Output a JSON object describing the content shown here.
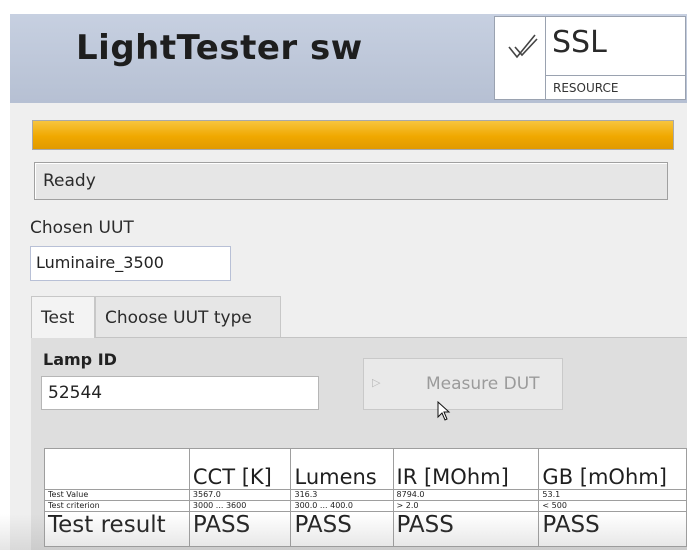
{
  "app": {
    "title": "LightTester sw"
  },
  "logo": {
    "text": "SSL",
    "subtext": "RESOURCE"
  },
  "progress": {
    "value": 1.0,
    "color": "#f0a800"
  },
  "status": {
    "text": "Ready"
  },
  "chosen_uut": {
    "label": "Chosen UUT",
    "value": "Luminaire_3500"
  },
  "tabs": [
    {
      "label": "Test",
      "active": true
    },
    {
      "label": "Choose UUT type",
      "active": false
    }
  ],
  "lamp": {
    "label": "Lamp ID",
    "value": "52544"
  },
  "measure_button": {
    "label": "Measure DUT",
    "icon": "play-icon",
    "enabled": false
  },
  "results": {
    "columns": [
      "",
      "CCT [K]",
      "Lumens",
      "IR [MOhm]",
      "GB [mOhm]"
    ],
    "rows": [
      {
        "label": "Test Value",
        "values": [
          "3567.0",
          "316.3",
          "8794.0",
          "53.1"
        ]
      },
      {
        "label": "Test criterion",
        "values": [
          "3000 ... 3600",
          "300.0 ... 400.0",
          "> 2.0",
          "< 500"
        ]
      },
      {
        "label": "Test result",
        "values": [
          "PASS",
          "PASS",
          "PASS",
          "PASS"
        ]
      }
    ]
  }
}
